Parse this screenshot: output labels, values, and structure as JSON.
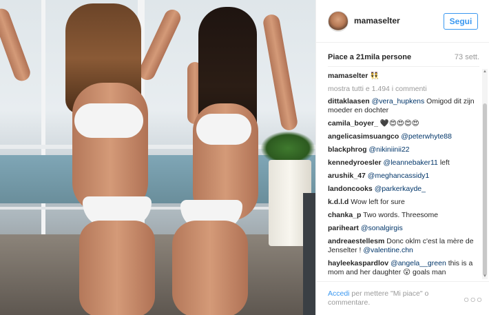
{
  "post": {
    "username": "mamaselter",
    "follow_label": "Segui",
    "likes": "Piace a 21mila persone",
    "time_ago": "73 sett.",
    "caption_user": "mamaselter",
    "caption_text": "👯",
    "show_all_comments": "mostra tutti e 1.494 i commenti"
  },
  "comments": [
    {
      "user": "dittaklaasen",
      "mention": "@vera_hupkens",
      "text": " Omigod dit zijn moeder en dochter"
    },
    {
      "user": "camila_boyer_",
      "mention": "",
      "text": " 🖤😍😍😍😍"
    },
    {
      "user": "angelicasimsuangco",
      "mention": "@peterwhyte88",
      "text": ""
    },
    {
      "user": "blackphrog",
      "mention": "@nikiniinii22",
      "text": ""
    },
    {
      "user": "kennedyroesler",
      "mention": "@leannebaker11",
      "text": " left"
    },
    {
      "user": "arushik_47",
      "mention": "@meghancassidy1",
      "text": ""
    },
    {
      "user": "landoncooks",
      "mention": "@parkerkayde_",
      "text": ""
    },
    {
      "user": "k.d.l.d",
      "mention": "",
      "text": " Wow left for sure"
    },
    {
      "user": "chanka_p",
      "mention": "",
      "text": " Two words. Threesome"
    },
    {
      "user": "pariheart",
      "mention": "@sonalgirgis",
      "text": ""
    },
    {
      "user": "andreaestellesm",
      "mention": "",
      "text": " Donc oklm c'est la mère de Jenselter ! ",
      "mention2": "@valentine.chn"
    },
    {
      "user": "hayleekaspardlov",
      "mention": "@angela__green",
      "text": " this is a mom and her daughter 😮 goals man"
    }
  ],
  "footer": {
    "login_label": "Accedi",
    "login_suffix": " per mettere \"Mi piace\" o commentare.",
    "more_icon": "ellipsis-icon"
  }
}
